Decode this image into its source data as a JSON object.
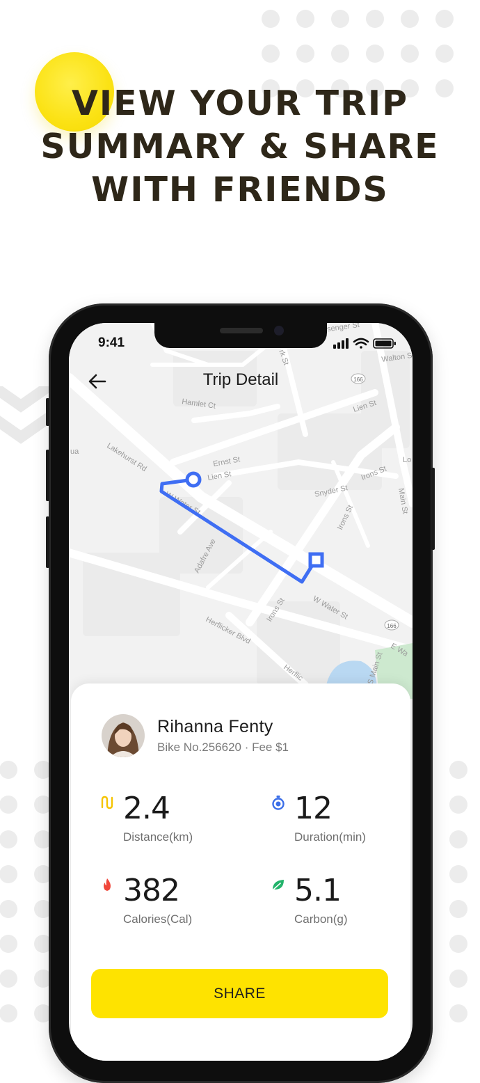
{
  "headline": {
    "line1": "VIEW YOUR TRIP",
    "line2": "SUMMARY & SHARE",
    "line3": "WITH FRIENDS"
  },
  "status_bar": {
    "time": "9:41"
  },
  "nav": {
    "title": "Trip Detail",
    "back_icon": "arrow-left-icon"
  },
  "map": {
    "streets": [
      "Hamlet Ct",
      "Lien St",
      "Lakehurst Rd",
      "Ernst St",
      "Lien St",
      "Snyder St",
      "Irons St",
      "Main St",
      "Adafre Ave",
      "W Water St",
      "W Water St",
      "Herflicker Blvd",
      "Irons St",
      "Irons St",
      "E Wa",
      "S Main St",
      "Herflic",
      "Walton S",
      "essenger St",
      "Lo",
      "ua",
      "rk St",
      "Ma"
    ],
    "route_shield": "166",
    "route_shield_2": "166",
    "route_color": "#3f6ef3"
  },
  "user": {
    "name": "Rihanna Fenty",
    "subtitle": "Bike No.256620 · Fee $1"
  },
  "stats": [
    {
      "value": "2.4",
      "label": "Distance(km)",
      "icon": "route-icon",
      "color": "#f5c400"
    },
    {
      "value": "12",
      "label": "Duration(min)",
      "icon": "stopwatch-icon",
      "color": "#3b6ee8"
    },
    {
      "value": "382",
      "label": "Calories(Cal)",
      "icon": "flame-icon",
      "color": "#f0463a"
    },
    {
      "value": "5.1",
      "label": "Carbon(g)",
      "icon": "leaf-icon",
      "color": "#23b36b"
    }
  ],
  "share_button": {
    "label": "SHARE"
  },
  "colors": {
    "accent": "#fee300",
    "headline": "#2e2719",
    "route": "#3f6ef3"
  }
}
